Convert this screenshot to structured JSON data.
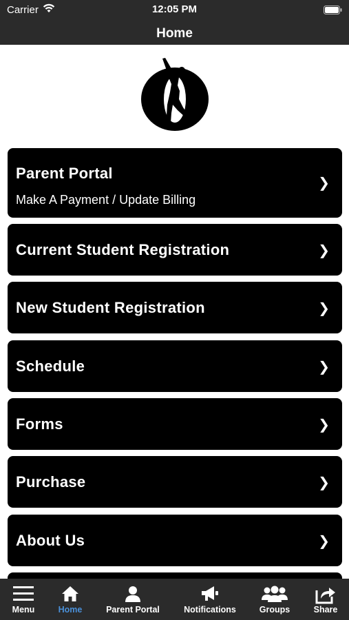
{
  "status_bar": {
    "carrier": "Carrier",
    "time": "12:05 PM"
  },
  "nav": {
    "title": "Home"
  },
  "menu": [
    {
      "label": "Parent Portal",
      "subtitle": "Make A Payment / Update Billing"
    },
    {
      "label": "Current Student Registration"
    },
    {
      "label": "New Student Registration"
    },
    {
      "label": "Schedule"
    },
    {
      "label": "Forms"
    },
    {
      "label": "Purchase"
    },
    {
      "label": "About Us"
    }
  ],
  "chevron": "❯",
  "tab_bar": {
    "items": [
      {
        "label": "Menu",
        "icon": "hamburger-icon"
      },
      {
        "label": "Home",
        "icon": "home-icon",
        "active": true
      },
      {
        "label": "Parent Portal",
        "icon": "person-icon"
      },
      {
        "label": "Notifications",
        "icon": "megaphone-icon"
      },
      {
        "label": "Groups",
        "icon": "groups-icon"
      },
      {
        "label": "Share",
        "icon": "share-icon"
      }
    ],
    "active_color": "#4a90d9"
  },
  "colors": {
    "bar_bg": "#2b2b2b",
    "button_bg": "#000000",
    "text": "#ffffff"
  }
}
